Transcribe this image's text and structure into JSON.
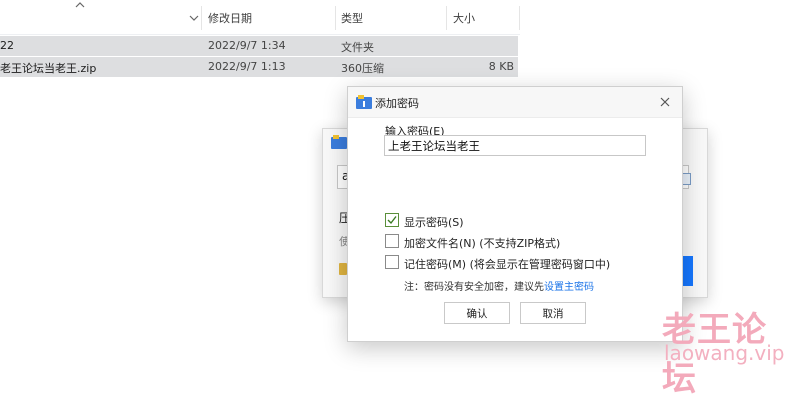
{
  "file_list": {
    "headers": {
      "date": "修改日期",
      "type": "类型",
      "size": "大小"
    },
    "rows": [
      {
        "name": "22",
        "date": "2022/9/7 1:34",
        "type": "文件夹",
        "size": ""
      },
      {
        "name": "老王论坛当老王.zip",
        "date": "2022/9/7 1:13",
        "type": "360压缩",
        "size": "8 KB"
      }
    ]
  },
  "background_dialog": {
    "input_char": "a",
    "label": "压",
    "label2": "使"
  },
  "dialog": {
    "title": "添加密码",
    "password_label": "输入密码(E)",
    "password_value": "上老王论坛当老王",
    "options": {
      "show_password": {
        "label": "显示密码(S)",
        "checked": true
      },
      "encrypt_filenames": {
        "label": "加密文件名(N) (不支持ZIP格式)",
        "checked": false
      },
      "remember_password": {
        "label": "记住密码(M) (将会显示在管理密码窗口中)",
        "checked": false
      }
    },
    "note_prefix": "注：密码没有安全加密，建议先",
    "note_link": "设置主密码",
    "ok_label": "确认",
    "cancel_label": "取消"
  },
  "watermark": {
    "cn": "老王论坛",
    "url": "laowang.vip"
  },
  "colors": {
    "row_selected": "#dddee0",
    "link": "#1a73e8",
    "accent_blue": "#1677ff",
    "watermark": "#f3aabb"
  }
}
